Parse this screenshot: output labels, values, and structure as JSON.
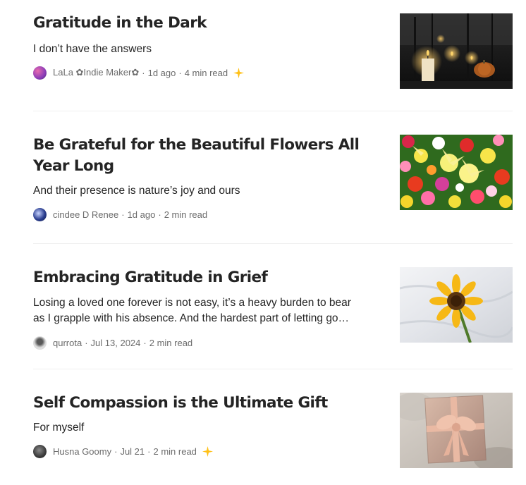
{
  "articles": [
    {
      "title": "Gratitude in the Dark",
      "subtitle": "I don’t have the answers",
      "author": "LaLa ✿Indie Maker✿",
      "date": "1d ago",
      "read_time": "4 min read",
      "member_only": true
    },
    {
      "title": "Be Grateful for the Beautiful Flowers All Year Long",
      "subtitle": "And their presence is nature’s joy and ours",
      "author": "cindee D Renee",
      "date": "1d ago",
      "read_time": "2 min read",
      "member_only": false
    },
    {
      "title": "Embracing Gratitude in Grief",
      "subtitle": "Losing a loved one forever is not easy, it’s a heavy burden to bear as I grapple with his absence. And the hardest part of letting go…",
      "author": "qurrota",
      "date": "Jul 13, 2024",
      "read_time": "2 min read",
      "member_only": false
    },
    {
      "title": "Self Compassion is the Ultimate Gift",
      "subtitle": "For myself",
      "author": "Husna Goomy",
      "date": "Jul 21",
      "read_time": "2 min read",
      "member_only": true
    }
  ],
  "separator": "·",
  "colors": {
    "star": "#ffc017",
    "meta": "#6b6b6b",
    "text": "#242424"
  }
}
